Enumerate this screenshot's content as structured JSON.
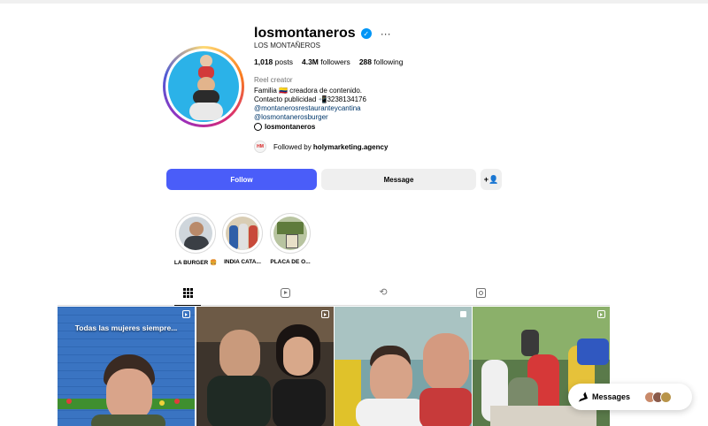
{
  "profile": {
    "username": "losmontaneros",
    "full_name": "LOS MONTAÑEROS",
    "verified_icon": "verified-badge-icon",
    "stats": {
      "posts_count": "1,018",
      "posts_label": "posts",
      "followers_count": "4.3M",
      "followers_label": "followers",
      "following_count": "288",
      "following_label": "following"
    },
    "category": "Reel creator",
    "bio_line1": "Familia 🇨🇴 creadora de contenido.",
    "bio_line2": "Contacto publicidad 📲3238134176",
    "bio_link1": "@montanerosrestauranteycantina",
    "bio_link2": "@losmontanerosburger",
    "threads_handle": "losmontaneros",
    "followed_by_prefix": "Followed by",
    "followed_by_name": "holymarketing.agency",
    "followed_by_avatar_text": "HM"
  },
  "actions": {
    "follow_label": "Follow",
    "message_label": "Message",
    "add_user_glyph": "+👤"
  },
  "highlights": [
    {
      "label": "LA BURGER 🍔"
    },
    {
      "label": "INDIA CATA..."
    },
    {
      "label": "PLACA DE O..."
    }
  ],
  "tabs": [
    {
      "name": "posts",
      "icon": "grid-icon",
      "active": true
    },
    {
      "name": "reels",
      "icon": "reels-icon",
      "active": false
    },
    {
      "name": "reposts",
      "icon": "repost-icon",
      "active": false
    },
    {
      "name": "tagged",
      "icon": "tagged-icon",
      "active": false
    }
  ],
  "posts": [
    {
      "caption": "Todas las mujeres siempre...",
      "type": "reel"
    },
    {
      "caption": "",
      "type": "reel"
    },
    {
      "caption": "",
      "type": "carousel"
    },
    {
      "caption": "",
      "type": "reel"
    }
  ],
  "messages": {
    "label": "Messages"
  },
  "colors": {
    "follow_button": "#4a5df9",
    "secondary_button": "#efefef",
    "link": "#00376b",
    "verified": "#0095f6",
    "avatar_background": "#2bb2e8"
  }
}
